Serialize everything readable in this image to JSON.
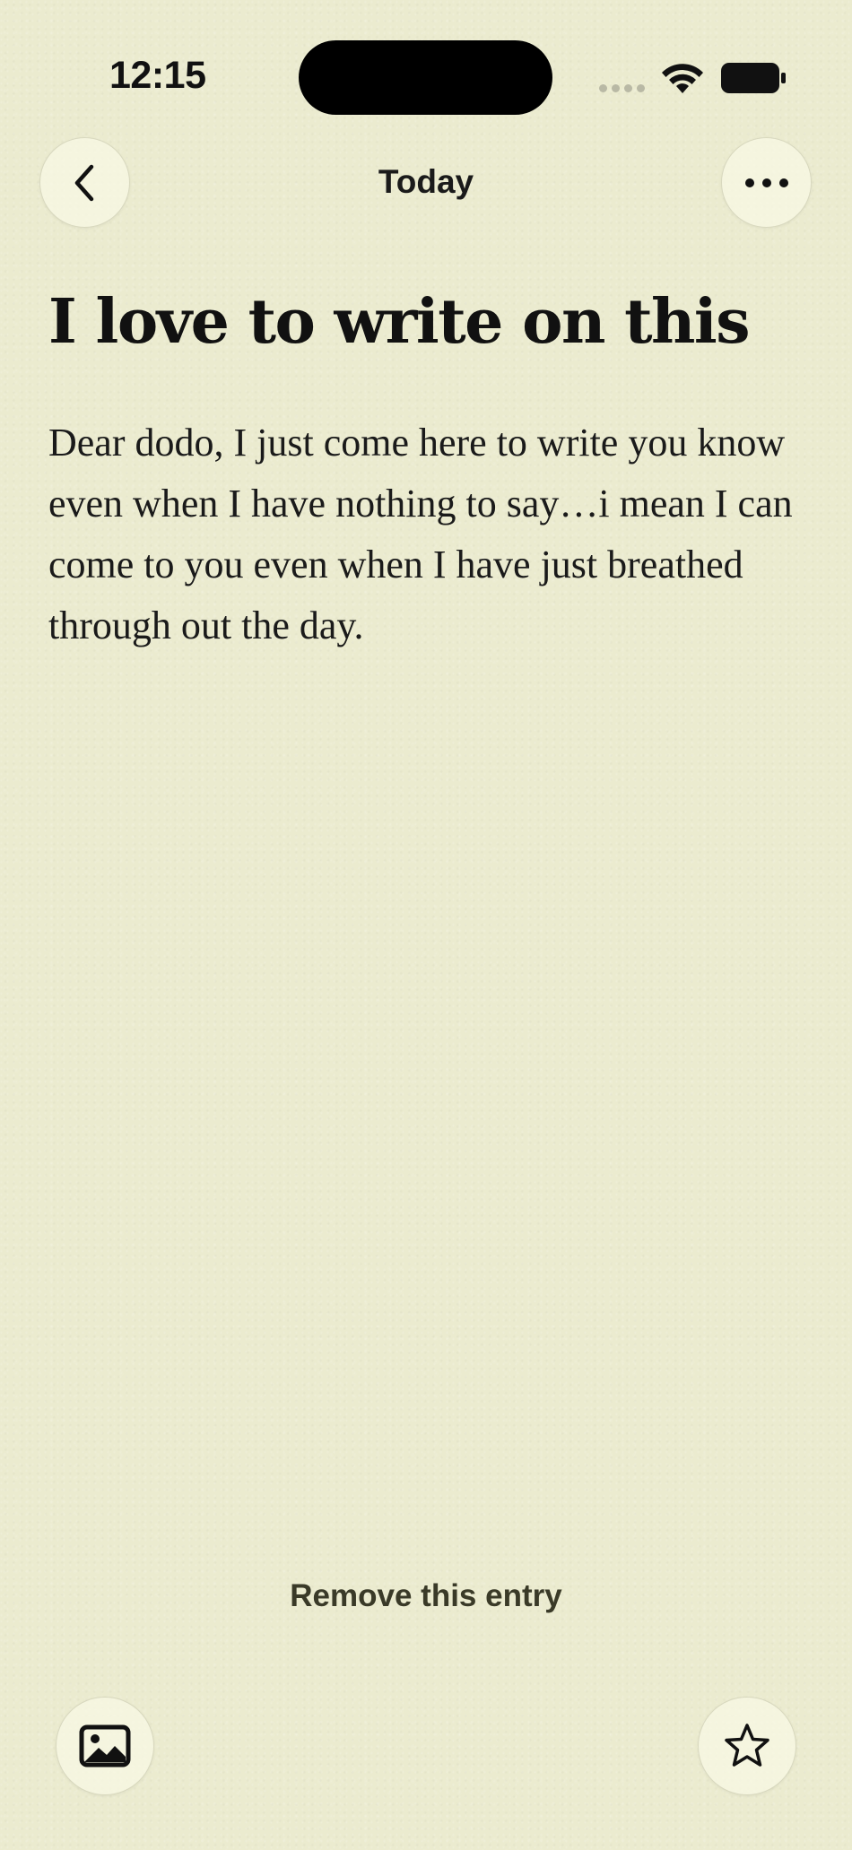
{
  "status_bar": {
    "time": "12:15"
  },
  "nav": {
    "title": "Today",
    "back_icon": "chevron-left-icon",
    "more_icon": "ellipsis-icon"
  },
  "entry": {
    "title": "I love to write on this",
    "body": "Dear dodo, I just come here to write you know even when I have nothing to say…i mean I can come to you even when I have just breathed through out the day."
  },
  "actions": {
    "remove_label": "Remove this entry",
    "photo_icon": "photo-icon",
    "favorite_icon": "star-icon"
  },
  "colors": {
    "background": "#ebebcf",
    "text": "#141414",
    "remove_text": "#3a3a28"
  }
}
